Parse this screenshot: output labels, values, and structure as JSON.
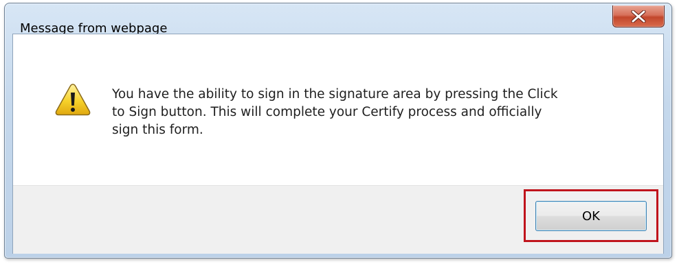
{
  "dialog": {
    "title": "Message from webpage",
    "close_icon": "close-icon",
    "message_icon": "warning-icon",
    "message": "You have the ability to sign in the signature area by pressing the Click\nto Sign button.  This will complete your Certify process and officially\nsign this form.",
    "ok_label": "OK"
  },
  "colors": {
    "highlight_border": "#c0141c",
    "close_button": "#c2472c",
    "warning_fill": "#f6d12a"
  }
}
